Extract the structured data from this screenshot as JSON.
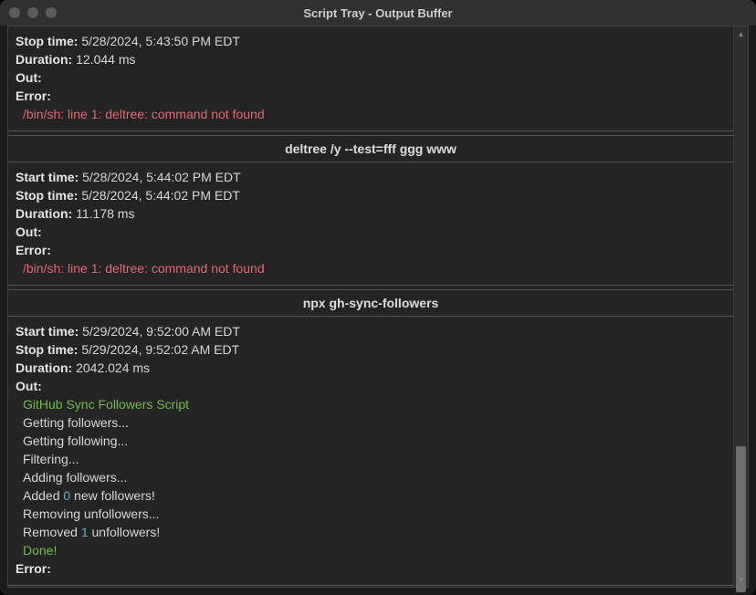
{
  "window_title": "Script Tray - Output Buffer",
  "colors": {
    "error": "#e06c75",
    "success": "#6fbf4a",
    "accent_num": "#56b6c2"
  },
  "labels": {
    "start_time": "Start time:",
    "stop_time": "Stop time:",
    "duration": "Duration:",
    "out": "Out:",
    "error": "Error:"
  },
  "entries": [
    {
      "show_header": false,
      "command": "",
      "start_time": "",
      "stop_time": "5/28/2024, 5:43:50 PM EDT",
      "duration": "12.044 ms",
      "out_lines": [],
      "error_lines": [
        {
          "text": "/bin/sh: line 1: deltree: command not found",
          "cls": "err"
        }
      ]
    },
    {
      "show_header": true,
      "command": "deltree /y --test=fff ggg www",
      "start_time": "5/28/2024, 5:44:02 PM EDT",
      "stop_time": "5/28/2024, 5:44:02 PM EDT",
      "duration": "11.178 ms",
      "out_lines": [],
      "error_lines": [
        {
          "text": "/bin/sh: line 1: deltree: command not found",
          "cls": "err"
        }
      ]
    },
    {
      "show_header": true,
      "command": "npx gh-sync-followers",
      "start_time": "5/29/2024, 9:52:00 AM EDT",
      "stop_time": "5/29/2024, 9:52:02 AM EDT",
      "duration": "2042.024 ms",
      "out_lines": [
        {
          "segments": [
            {
              "text": "GitHub Sync Followers Script",
              "cls": "green"
            }
          ]
        },
        {
          "segments": [
            {
              "text": "Getting followers...",
              "cls": ""
            }
          ]
        },
        {
          "segments": [
            {
              "text": "Getting following...",
              "cls": ""
            }
          ]
        },
        {
          "segments": [
            {
              "text": "Filtering...",
              "cls": ""
            }
          ]
        },
        {
          "segments": [
            {
              "text": "Adding followers...",
              "cls": ""
            }
          ]
        },
        {
          "segments": [
            {
              "text": "Added ",
              "cls": ""
            },
            {
              "text": "0",
              "cls": "cyan"
            },
            {
              "text": " new followers!",
              "cls": ""
            }
          ]
        },
        {
          "segments": [
            {
              "text": "Removing unfollowers...",
              "cls": ""
            }
          ]
        },
        {
          "segments": [
            {
              "text": "Removed ",
              "cls": ""
            },
            {
              "text": "1",
              "cls": "cyan"
            },
            {
              "text": " unfollowers!",
              "cls": ""
            }
          ]
        },
        {
          "segments": [
            {
              "text": "Done!",
              "cls": "green"
            }
          ]
        }
      ],
      "error_lines": []
    }
  ]
}
